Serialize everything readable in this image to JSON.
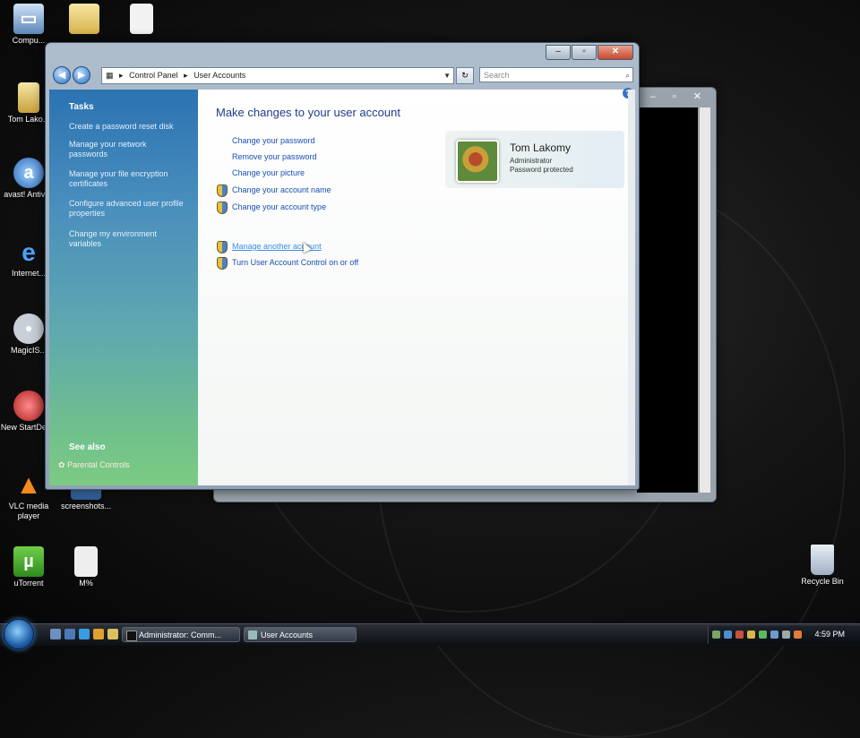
{
  "desktop": {
    "icons": [
      {
        "label": "Compu..."
      },
      {
        "label": ""
      },
      {
        "label": ""
      },
      {
        "label": "Tom Lako..."
      },
      {
        "label": "avast! Antivi..."
      },
      {
        "label": "Internet..."
      },
      {
        "label": "MagicIS..."
      },
      {
        "label": "New StartDev..."
      },
      {
        "label": "VLC media player"
      },
      {
        "label": "screenshots..."
      },
      {
        "label": "uTorrent"
      },
      {
        "label": "M%"
      },
      {
        "label": "Recycle Bin"
      }
    ]
  },
  "window": {
    "address": {
      "segments": [
        "Control Panel",
        "User Accounts"
      ]
    },
    "search_placeholder": "Search",
    "sidebar": {
      "tasks_heading": "Tasks",
      "tasks": [
        "Create a password reset disk",
        "Manage your network passwords",
        "Manage your file encryption certificates",
        "Configure advanced user profile properties",
        "Change my environment variables"
      ],
      "see_also_heading": "See also",
      "see_also": [
        "Parental Controls"
      ]
    },
    "main": {
      "heading": "Make changes to your user account",
      "links": [
        "Change your password",
        "Remove your password",
        "Change your picture",
        "Change your account name",
        "Change your account type"
      ],
      "links2": [
        "Manage another account",
        "Turn User Account Control on or off"
      ]
    },
    "user": {
      "name": "Tom Lakomy",
      "role": "Administrator",
      "status": "Password protected"
    }
  },
  "taskbar": {
    "buttons": [
      "Administrator: Comm...",
      "User Accounts"
    ],
    "clock": "4:59 PM"
  }
}
